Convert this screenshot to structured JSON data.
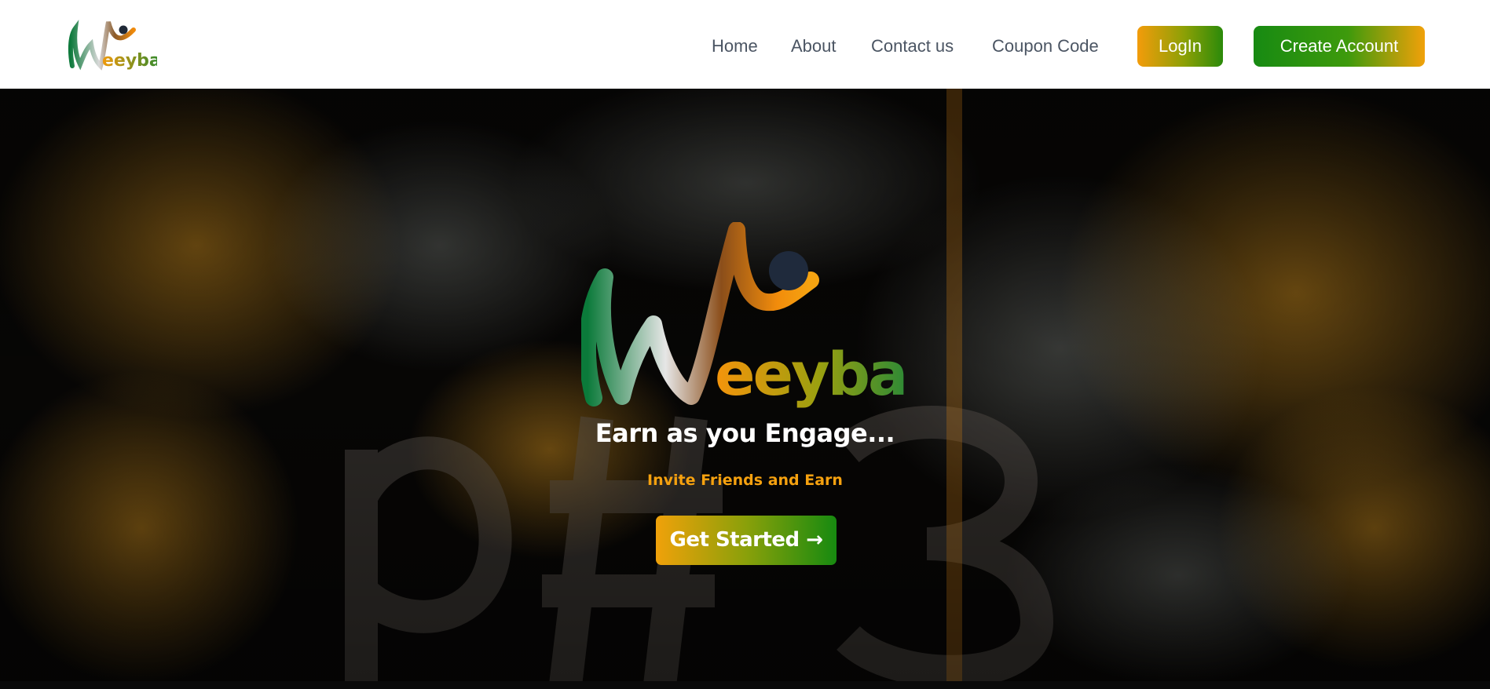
{
  "brand": {
    "logo_text": "Weeyba"
  },
  "nav": {
    "items": [
      {
        "label": "Home"
      },
      {
        "label": "About"
      },
      {
        "label": "Contact us"
      },
      {
        "label": "Coupon Code"
      }
    ],
    "login_label": "LogIn",
    "create_label": "Create Account"
  },
  "hero": {
    "logo_text": "Weeyba",
    "tagline": "Earn as you Engage...",
    "subline": "Invite Friends and Earn",
    "cta_label": "Get Started →"
  },
  "colors": {
    "orange": "#f39c0b",
    "green": "#178a12",
    "nav_text": "#4b5563",
    "hero_bg": "#050505"
  }
}
